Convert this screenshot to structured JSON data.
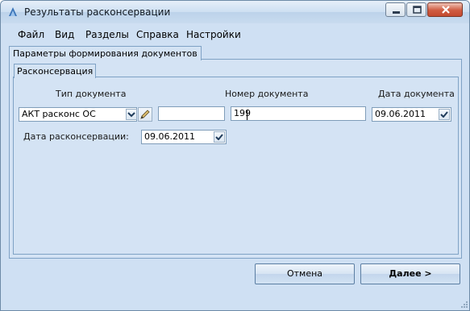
{
  "window": {
    "title": "Результаты расконсервации",
    "controls": {
      "minimize": "minimize-icon",
      "maximize": "maximize-icon",
      "close": "close-icon"
    }
  },
  "menu": {
    "items": [
      "Файл",
      "Вид",
      "Разделы",
      "Справка",
      "Настройки"
    ]
  },
  "tabs": {
    "outer": "Параметры формирования документов",
    "inner": "Расконсервация"
  },
  "form": {
    "doc_type_label": "Тип документа",
    "doc_type_value": "АКТ расконс ОС",
    "doc_series_value": "",
    "doc_number_label": "Номер документа",
    "doc_number_value": "199",
    "doc_date_label": "Дата документа",
    "doc_date_value": "09.06.2011",
    "unpreserve_date_label": "Дата расконсервации:",
    "unpreserve_date_value": "09.06.2011"
  },
  "buttons": {
    "cancel": "Отмена",
    "next": "Далее >"
  },
  "colors": {
    "window_bg": "#cfe0f3",
    "panel_border": "#7fa2c5",
    "close_button": "#cf5b41"
  }
}
